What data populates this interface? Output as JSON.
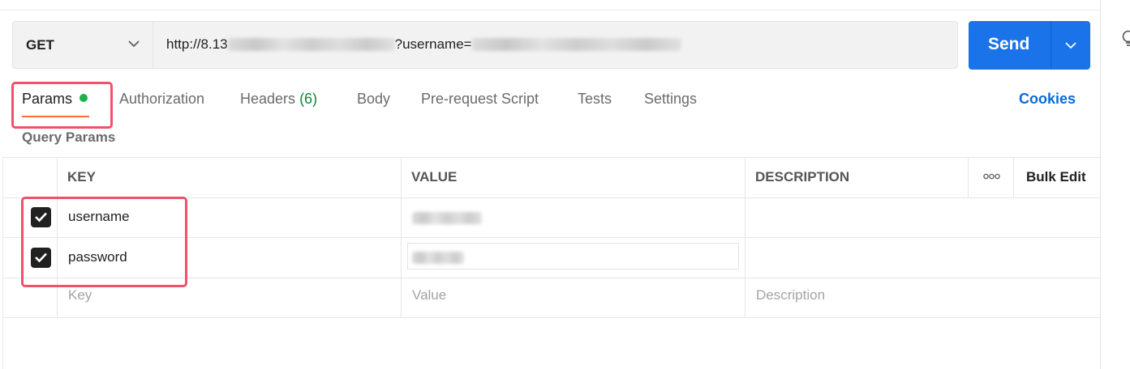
{
  "request": {
    "method": "GET",
    "url_visible_start": "http://8.13",
    "url_visible_middle": "?username=",
    "send_label": "Send"
  },
  "tabs": [
    {
      "label": "Params",
      "active": true,
      "indicator": "green-dot"
    },
    {
      "label": "Authorization"
    },
    {
      "label": "Headers",
      "count": "(6)"
    },
    {
      "label": "Body"
    },
    {
      "label": "Pre-request Script"
    },
    {
      "label": "Tests"
    },
    {
      "label": "Settings"
    }
  ],
  "cookies_label": "Cookies",
  "query_params": {
    "title": "Query Params",
    "headers": {
      "key": "KEY",
      "value": "VALUE",
      "description": "DESCRIPTION",
      "bulk_edit": "Bulk Edit"
    },
    "rows": [
      {
        "checked": true,
        "key": "username"
      },
      {
        "checked": true,
        "key": "password"
      }
    ],
    "placeholders": {
      "key": "Key",
      "value": "Value",
      "description": "Description"
    }
  },
  "colors": {
    "accent_blue": "#1a73e8",
    "active_tab_underline": "#ff6c37",
    "status_green": "#17b34a",
    "annotation_red": "#f0516b",
    "cookies_link": "#0b6ad6"
  },
  "icons": [
    "chevron-down-icon",
    "send-dropdown-chevron-icon",
    "checkbox-checked-icon",
    "more-options-icon",
    "lightbulb-icon"
  ]
}
